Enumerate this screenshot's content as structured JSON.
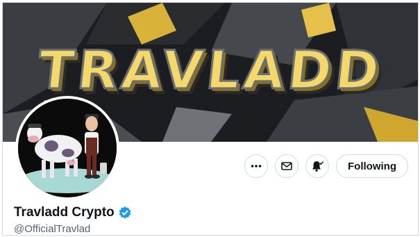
{
  "banner": {
    "text": "TRAVLADD"
  },
  "profile": {
    "display_name": "Travladd Crypto",
    "handle": "@OfficialTravlad",
    "verified": true
  },
  "actions": {
    "more_icon": "more-horizontal-icon",
    "message_icon": "envelope-icon",
    "notify_icon": "bell-check-icon",
    "follow_label": "Following"
  },
  "colors": {
    "verified_badge": "#1d9bf0",
    "banner_gold": "#f5d86a",
    "text_primary": "#0f1419",
    "text_secondary": "#536471",
    "border": "#cfd9de"
  }
}
